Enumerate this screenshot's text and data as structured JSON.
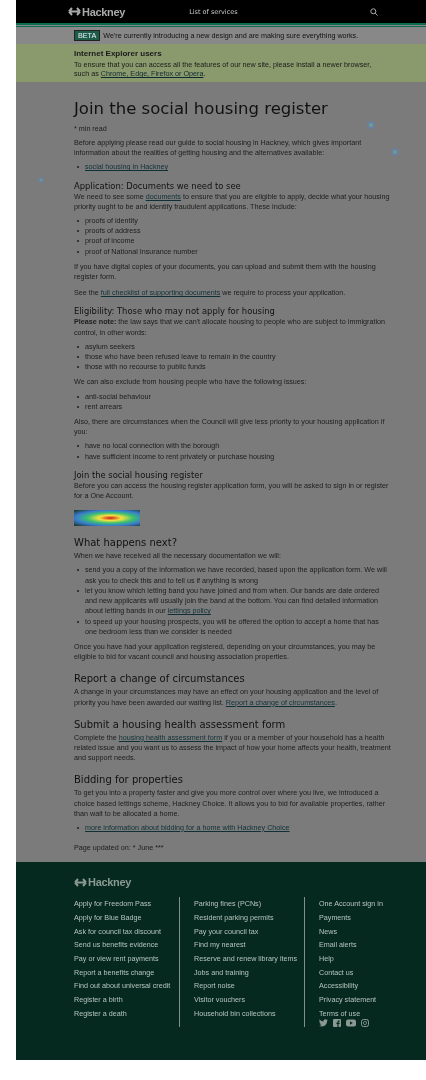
{
  "header": {
    "logo": "Hackney",
    "nav": "List of services"
  },
  "beta": {
    "tag": "BETA",
    "text": "We're currently introducing a new design and are making sure everything works."
  },
  "ie_banner": {
    "title": "Internet Explorer users",
    "parts": [
      {
        "text": "To ensure that you can access all the features of our new site, please install a newer browser, such as "
      },
      {
        "link": "Chrome, Edge, Firefox or Opera"
      },
      {
        "text": "."
      }
    ]
  },
  "article": {
    "title": "Join the social housing register",
    "read_time": "* min read",
    "blocks": [
      {
        "kind": "paragraph",
        "parts": [
          {
            "text": "Before applying please read our guide to social housing in Hackney, which gives important information about the realities of getting housing and the alternatives available:"
          }
        ]
      },
      {
        "kind": "list",
        "items": [
          [
            {
              "link": "social housing in Hackney"
            }
          ]
        ]
      },
      {
        "kind": "subheading",
        "text": "Application: Documents we need to see"
      },
      {
        "kind": "paragraph",
        "parts": [
          {
            "text": "We need to see some "
          },
          {
            "link": "documents"
          },
          {
            "text": " to ensure that you are eligible to apply, decide what your housing priority ought to be and identify fraudulent applications. These include:"
          }
        ]
      },
      {
        "kind": "list",
        "items": [
          [
            {
              "text": "proofs of identity"
            }
          ],
          [
            {
              "text": "proofs of address"
            }
          ],
          [
            {
              "text": "proof of income"
            }
          ],
          [
            {
              "text": "proof of National Insurance number"
            }
          ]
        ]
      },
      {
        "kind": "paragraph",
        "parts": [
          {
            "text": "If you have digital copies of your documents, you can upload and submit them with the housing register form."
          }
        ]
      },
      {
        "kind": "paragraph",
        "parts": [
          {
            "text": "See the "
          },
          {
            "link": "full checklist of supporting documents"
          },
          {
            "text": " we require to process your application."
          }
        ]
      },
      {
        "kind": "subheading",
        "text": "Eligibility: Those who may not apply for housing"
      },
      {
        "kind": "paragraph",
        "parts": [
          {
            "text": "**Please note:** the law says that we can't allocate housing to people who are subject to immigration control, in other words:"
          }
        ]
      },
      {
        "kind": "list",
        "items": [
          [
            {
              "text": "asylum seekers"
            }
          ],
          [
            {
              "text": "those who have been refused leave to remain in the country"
            }
          ],
          [
            {
              "text": "those with no recourse to public funds"
            }
          ]
        ]
      },
      {
        "kind": "paragraph",
        "parts": [
          {
            "text": "We can also exclude from housing people who have the following issues:"
          }
        ]
      },
      {
        "kind": "list",
        "items": [
          [
            {
              "text": "anti-social behaviour"
            }
          ],
          [
            {
              "text": "rent arrears"
            }
          ]
        ]
      },
      {
        "kind": "paragraph",
        "parts": [
          {
            "text": "Also, there are circumstances when the Council will give less priority to your housing application if you:"
          }
        ]
      },
      {
        "kind": "list",
        "items": [
          [
            {
              "text": "have no local connection with the borough"
            }
          ],
          [
            {
              "text": "have sufficient income to rent privately or purchase housing"
            }
          ]
        ]
      },
      {
        "kind": "subheading",
        "text": "Join the social housing register"
      },
      {
        "kind": "paragraph",
        "parts": [
          {
            "text": "Before you can access the housing register application form, you will be asked to sign in or register for a One Account."
          }
        ]
      },
      {
        "kind": "button"
      },
      {
        "kind": "heading",
        "text": "What happens next?"
      },
      {
        "kind": "paragraph",
        "parts": [
          {
            "text": "When we have received all the necessary documentation we will:"
          }
        ]
      },
      {
        "kind": "list",
        "items": [
          [
            {
              "text": "send you a copy of the information we have recorded, based upon the application form. We will ask you to check this and to tell us if anything is wrong"
            }
          ],
          [
            {
              "text": "let you know which letting band you have joined and from when. Our bands are date ordered and new applicants will usually join the band at the bottom. You can find detailed information about letting bands in our "
            },
            {
              "link": "lettings policy"
            }
          ],
          [
            {
              "text": "to speed up your housing prospects, you will be offered the option to accept a home that has one bedroom less than we consider is needed"
            }
          ]
        ]
      },
      {
        "kind": "paragraph",
        "parts": [
          {
            "text": "Once you have had your application registered, depending on your circumstances, you may be eligible to bid for vacant council and housing association properties."
          }
        ]
      },
      {
        "kind": "heading",
        "text": "Report a change of circumstances"
      },
      {
        "kind": "paragraph",
        "parts": [
          {
            "text": "A change in your circumstances may have an effect on your housing application and the level of priority you have been awarded our waiting list. "
          },
          {
            "link": "Report a change of circumstances"
          },
          {
            "text": "."
          }
        ]
      },
      {
        "kind": "heading",
        "text": "Submit a housing health assessment form"
      },
      {
        "kind": "paragraph",
        "parts": [
          {
            "text": "Complete the "
          },
          {
            "link": "housing health assessment form"
          },
          {
            "text": " if you or a member of your household has a health related issue and you want us to assess the impact of how your home affects your health, treatment and support needs."
          }
        ]
      },
      {
        "kind": "heading",
        "text": "Bidding for properties"
      },
      {
        "kind": "paragraph",
        "parts": [
          {
            "text": "To get you into a property faster and give you more control over where you live, we introduced a choice based lettings scheme, Hackney Choice. It allows you to bid for available properties, rather than wait to be allocated a home."
          }
        ]
      },
      {
        "kind": "list",
        "items": [
          [
            {
              "link": "more information about bidding for a home with Hackney Choice"
            }
          ]
        ]
      }
    ],
    "updated": "Page updated on: * June ***"
  },
  "footer": {
    "logo": "Hackney",
    "columns": [
      [
        "Apply for Freedom Pass",
        "Apply for Blue Badge",
        "Ask for council tax discount",
        "Send us benefits evidence",
        "Pay or view rent payments",
        "Report a benefits change",
        "Find out about universal credit",
        "Register a birth",
        "Register a death"
      ],
      [
        "Parking fines (PCNs)",
        "Resident parking permits",
        "Pay your council tax",
        "Find my nearest",
        "Reserve and renew library items",
        "Jobs and training",
        "Report noise",
        "Visitor vouchers",
        "Household bin collections"
      ],
      [
        "One Account sign in",
        "Payments",
        "News",
        "Email alerts",
        "Help",
        "Contact us",
        "Accessibility",
        "Privacy statement",
        "Terms of use"
      ]
    ],
    "social": [
      {
        "kind": "twitter"
      },
      {
        "kind": "facebook"
      },
      {
        "kind": "youtube"
      },
      {
        "kind": "instagram"
      }
    ]
  }
}
